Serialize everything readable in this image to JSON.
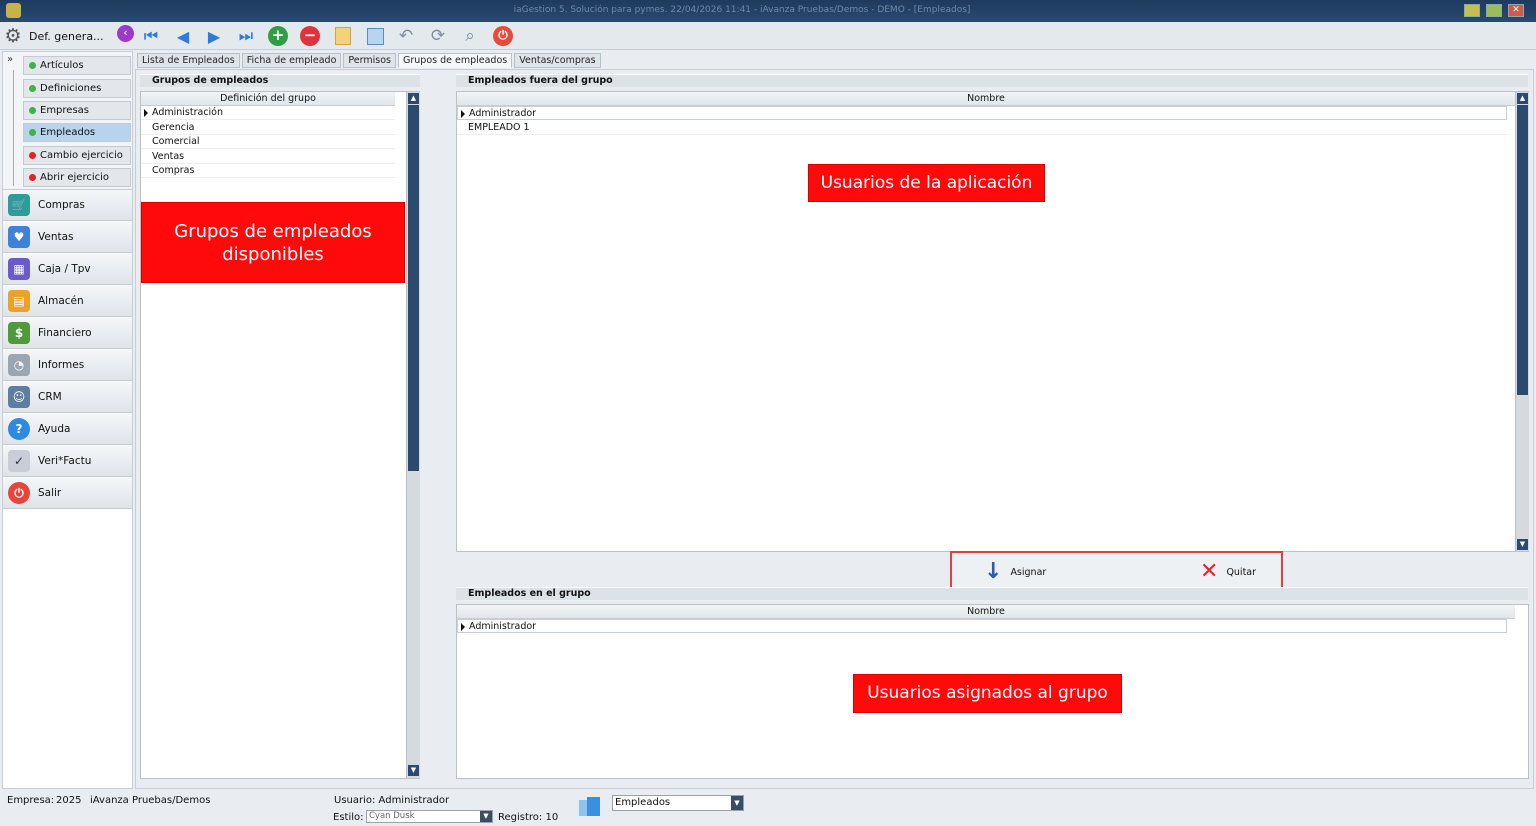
{
  "window": {
    "title": "iaGestion 5. Solución para pymes.   22/04/2026 11:41  -  iAvanza Pruebas/Demos - DEMO - [Empleados]"
  },
  "toolbar": {
    "def_label": "Def. genera..."
  },
  "sidebar": {
    "sub_items": [
      {
        "label": "Artículos",
        "status": "green"
      },
      {
        "label": "Definiciones",
        "status": "green"
      },
      {
        "label": "Empresas",
        "status": "green"
      },
      {
        "label": "Empleados",
        "status": "green"
      },
      {
        "label": "Cambio ejercicio",
        "status": "red"
      },
      {
        "label": "Abrir ejercicio",
        "status": "red"
      }
    ],
    "modules": [
      {
        "label": "Compras",
        "icon": "cart-icon"
      },
      {
        "label": "Ventas",
        "icon": "heart-icon"
      },
      {
        "label": "Caja / Tpv",
        "icon": "register-icon"
      },
      {
        "label": "Almacén",
        "icon": "warehouse-icon"
      },
      {
        "label": "Financiero",
        "icon": "finance-icon"
      },
      {
        "label": "Informes",
        "icon": "report-icon"
      },
      {
        "label": "CRM",
        "icon": "person-icon"
      },
      {
        "label": "Ayuda",
        "icon": "help-icon"
      },
      {
        "label": "Veri*Factu",
        "icon": "verifactu-icon"
      },
      {
        "label": "Salir",
        "icon": "power-icon"
      }
    ]
  },
  "tabs": [
    "Lista de Empleados",
    "Ficha de empleado",
    "Permisos",
    "Grupos de empleados",
    "Ventas/compras"
  ],
  "groups_panel": {
    "title": "Grupos de empleados",
    "column": "Definición del grupo",
    "rows": [
      "Administración",
      "Gerencia",
      "Comercial",
      "Ventas",
      "Compras"
    ]
  },
  "outside_panel": {
    "title": "Empleados fuera del grupo",
    "column": "Nombre",
    "rows": [
      "Administrador",
      "EMPLEADO 1"
    ]
  },
  "inside_panel": {
    "title": "Empleados en el grupo",
    "column": "Nombre",
    "rows": [
      "Administrador"
    ]
  },
  "actions": {
    "assign": "Asignar",
    "remove": "Quitar"
  },
  "callouts": {
    "groups_line1": "Grupos de empleados",
    "groups_line2": "disponibles",
    "users": "Usuarios de la aplicación",
    "assigned": "Usuarios asignados al grupo"
  },
  "status": {
    "empresa_label": "Empresa:",
    "empresa_year": "2025",
    "empresa_name": "iAvanza Pruebas/Demos",
    "usuario": "Usuario: Administrador",
    "estilo_label": "Estilo:",
    "estilo_value": "Cyan Dusk",
    "registro": "Registro:  10",
    "module_select": "Empleados"
  },
  "colors": {
    "callout": "#ff0a0a",
    "accent_blue": "#2a7be0",
    "titlebar": "#1d3a5f"
  }
}
